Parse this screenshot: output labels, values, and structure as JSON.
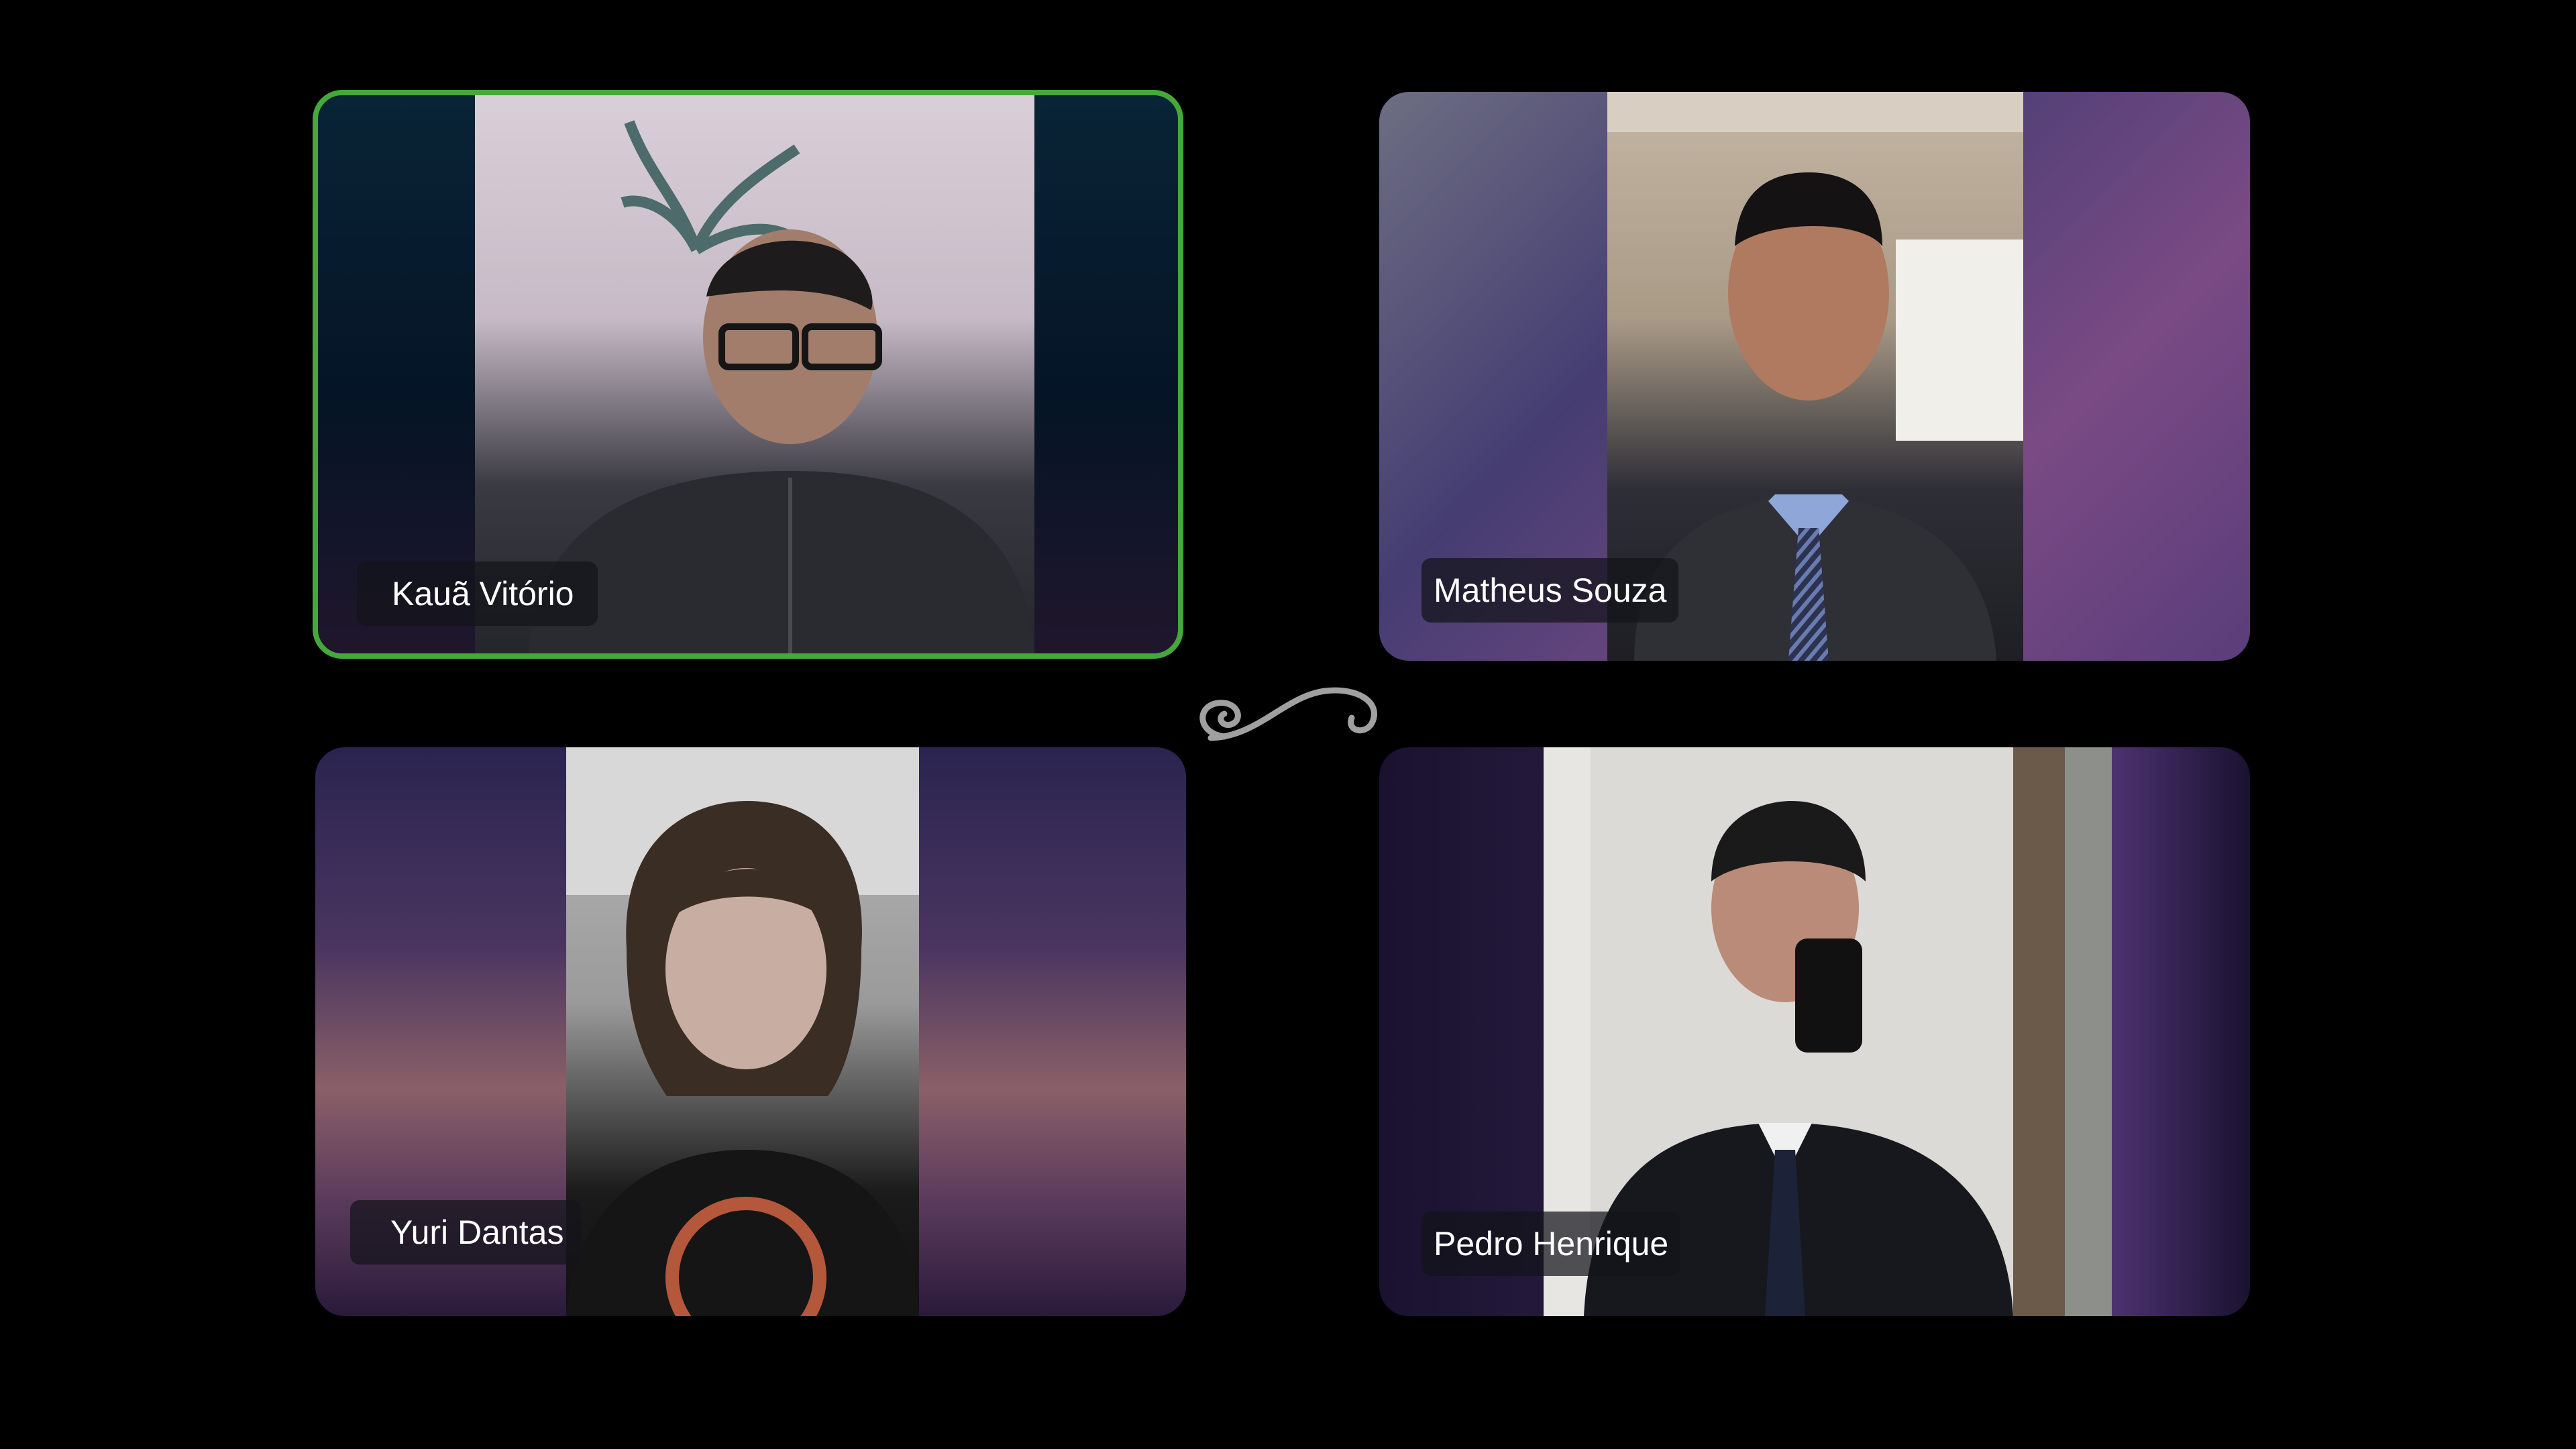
{
  "participants": [
    {
      "name": "Kauã Vitório",
      "speaking": true
    },
    {
      "name": "Matheus Souza",
      "speaking": false
    },
    {
      "name": "Yuri Dantas",
      "speaking": false
    },
    {
      "name": "Pedro Henrique",
      "speaking": false
    }
  ],
  "colors": {
    "background": "#000000",
    "active_speaker_border": "#46a83a",
    "name_badge_bg": "rgba(20,20,26,0.72)",
    "name_text": "#ffffff"
  },
  "icons": {
    "ornament": "swirl-ornament-icon"
  }
}
